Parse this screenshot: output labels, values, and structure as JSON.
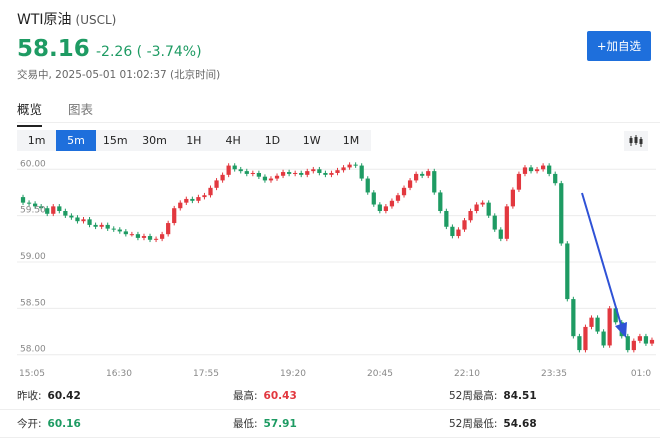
{
  "header": {
    "name": "WTI原油",
    "symbol": "(USCL)",
    "price": "58.16",
    "change": "-2.26 ( -3.74%)",
    "status": "交易中, 2025-05-01 01:02:37 (北京时间)",
    "watch_button": "+加自选"
  },
  "tabs": [
    {
      "label": "概览",
      "active": true
    },
    {
      "label": "图表",
      "active": false
    }
  ],
  "intervals": [
    "1m",
    "5m",
    "15m",
    "30m",
    "1H",
    "4H",
    "1D",
    "1W",
    "1M"
  ],
  "active_interval": "5m",
  "chart_type_icon": "candlestick-icon",
  "colors": {
    "up": "#e2383f",
    "down": "#1e9b63",
    "accent": "#1e6fdc",
    "annotation": "#2f52d6"
  },
  "chart_data": {
    "type": "candlestick",
    "y_ticks": [
      "60.00",
      "59.50",
      "59.00",
      "58.50",
      "58.00"
    ],
    "x_ticks": [
      "15:05",
      "16:30",
      "17:55",
      "19:20",
      "20:45",
      "22:10",
      "23:35",
      "01:0"
    ],
    "ylim": [
      57.9,
      60.1
    ],
    "grid": true,
    "close_series": [
      59.64,
      59.63,
      59.6,
      59.58,
      59.52,
      59.6,
      59.55,
      59.5,
      59.48,
      59.44,
      59.46,
      59.4,
      59.38,
      59.4,
      59.36,
      59.35,
      59.33,
      59.3,
      59.3,
      59.26,
      59.28,
      59.24,
      59.25,
      59.3,
      59.42,
      59.58,
      59.64,
      59.68,
      59.66,
      59.7,
      59.72,
      59.8,
      59.88,
      59.94,
      60.04,
      60.0,
      59.98,
      59.95,
      59.96,
      59.92,
      59.88,
      59.9,
      59.93,
      59.97,
      59.95,
      59.96,
      59.94,
      59.98,
      60.0,
      59.96,
      59.94,
      59.96,
      59.99,
      60.02,
      60.05,
      60.04,
      59.9,
      59.75,
      59.62,
      59.55,
      59.6,
      59.66,
      59.72,
      59.8,
      59.88,
      59.95,
      59.93,
      59.98,
      59.75,
      59.55,
      59.38,
      59.28,
      59.35,
      59.45,
      59.55,
      59.62,
      59.64,
      59.5,
      59.35,
      59.25,
      59.6,
      59.78,
      59.95,
      60.02,
      59.98,
      60.0,
      60.04,
      59.95,
      59.85,
      59.2,
      58.6,
      58.2,
      58.05,
      58.3,
      58.4,
      58.25,
      58.1,
      58.5,
      58.35,
      58.2,
      58.05,
      58.15,
      58.2,
      58.12,
      58.16
    ],
    "summary": {
      "prev_close": {
        "label": "昨收:",
        "value": "60.42"
      },
      "open": {
        "label": "今开:",
        "value": "60.16"
      },
      "high": {
        "label": "最高:",
        "value": "60.43"
      },
      "low": {
        "label": "最低:",
        "value": "57.91"
      },
      "wk52_high": {
        "label": "52周最高:",
        "value": "84.51"
      },
      "wk52_low": {
        "label": "52周最低:",
        "value": "54.68"
      }
    }
  }
}
